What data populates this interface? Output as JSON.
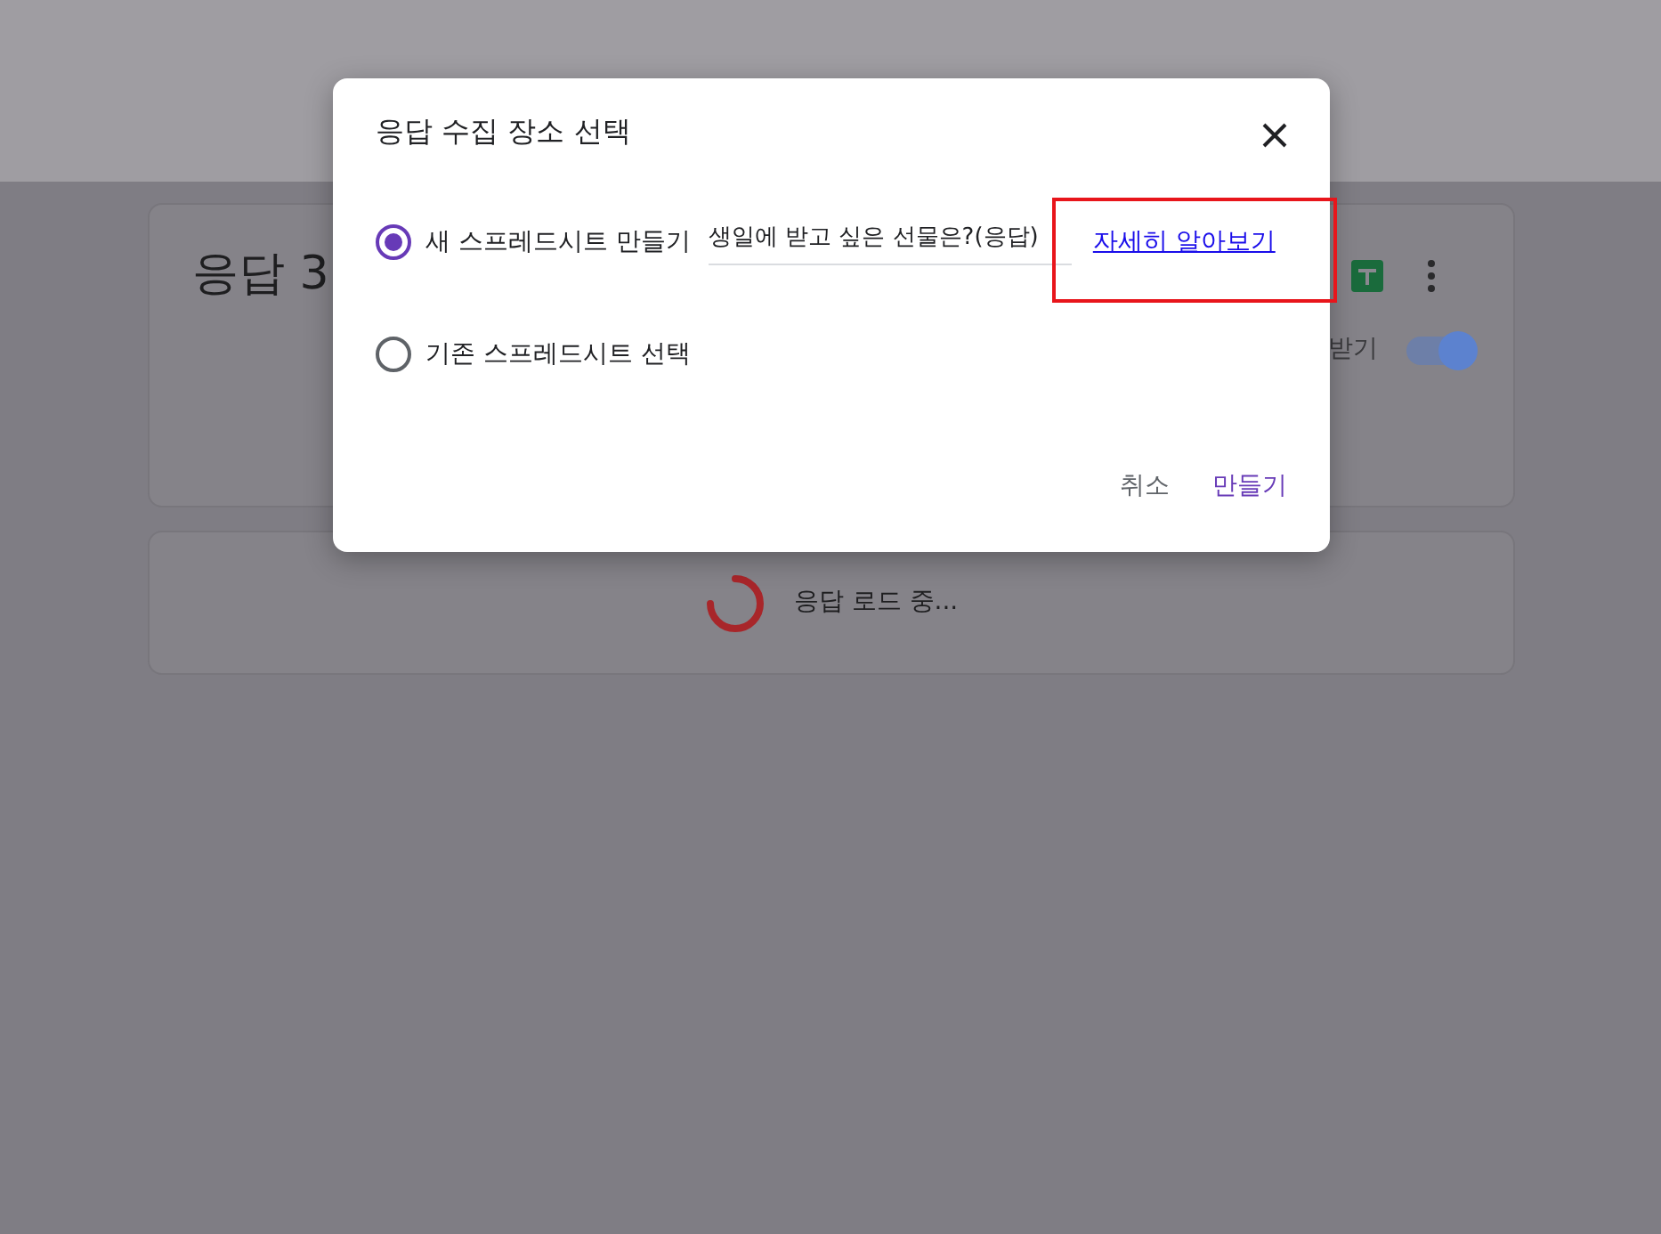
{
  "background": {
    "response_card": {
      "title": "응답 3",
      "toggle_label": "받기",
      "toggle_on": true
    },
    "loading_card": {
      "text": "응답 로드 중..."
    }
  },
  "dialog": {
    "title": "응답 수집 장소 선택",
    "options": [
      {
        "label": "새 스프레드시트 만들기",
        "selected": true
      },
      {
        "label": "기존 스프레드시트 선택",
        "selected": false
      }
    ],
    "spreadsheet_name": "생일에 받고 싶은 선물은?(응답)",
    "learn_more_link": "자세히 알아보기",
    "buttons": [
      {
        "label": "취소",
        "kind": "secondary"
      },
      {
        "label": "만들기",
        "kind": "primary"
      }
    ]
  }
}
